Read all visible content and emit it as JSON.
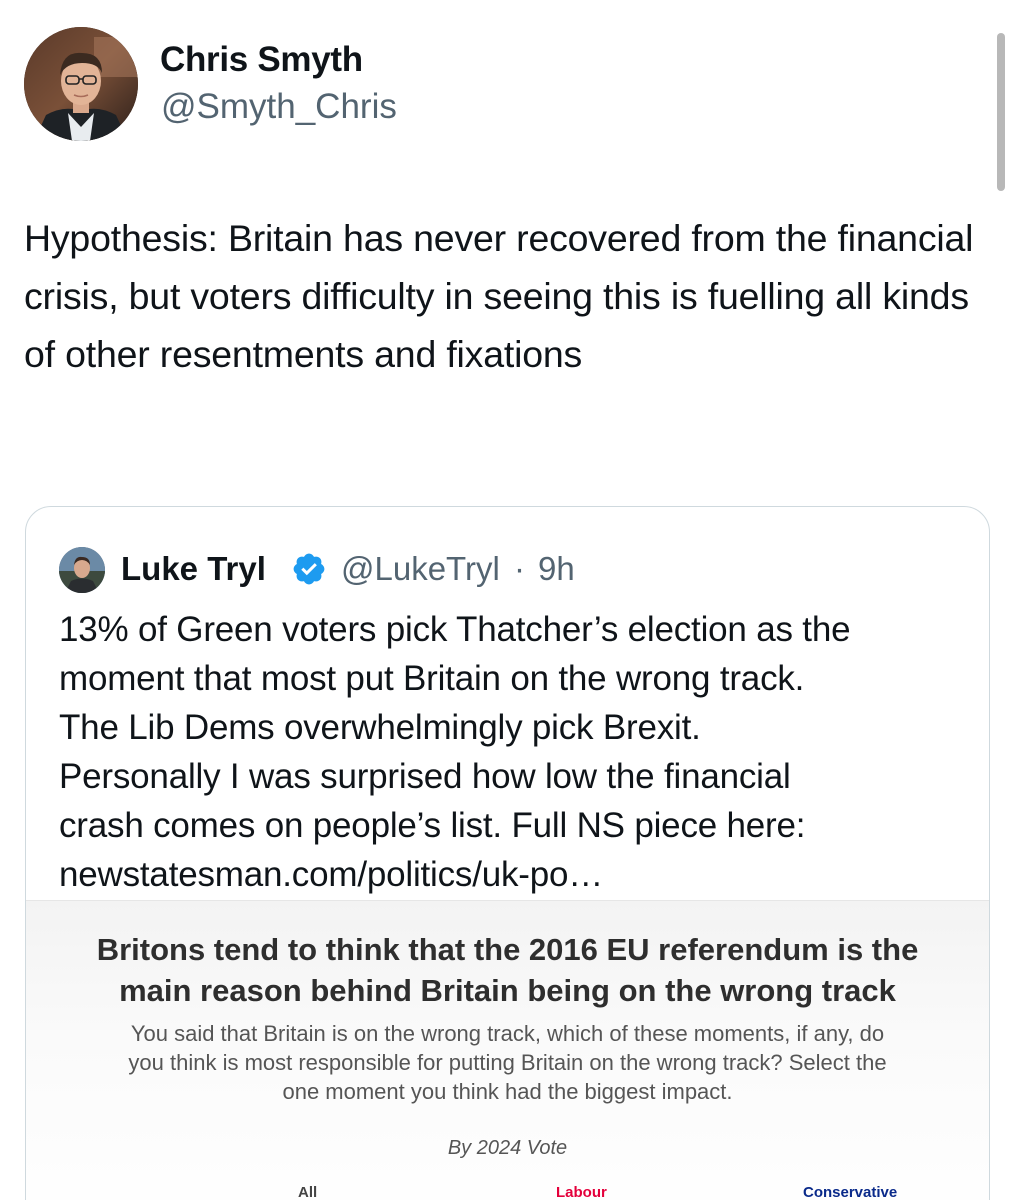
{
  "colors": {
    "handle_gray": "#536471",
    "text_dark": "#0f1419",
    "verified_blue": "#1d9bf0",
    "labour_red": "#e4003b",
    "conservative_blue": "#0a2a8a"
  },
  "author": {
    "name": "Chris Smyth",
    "handle": "@Smyth_Chris"
  },
  "tweet": {
    "text": "Hypothesis: Britain has never recovered from the financial crisis, but voters difficulty in seeing this is fuelling all kinds of other resentments and fixations"
  },
  "quoted": {
    "name": "Luke Tryl",
    "handle": "@LukeTryl",
    "separator": "·",
    "time": "9h",
    "verified_icon": "verified-badge-icon",
    "text_lines": [
      "13% of Green voters pick Thatcher’s  election as the",
      "moment that most put Britain on the wrong track.",
      "The Lib Dems overwhelmingly pick Brexit.",
      "Personally I was surprised how low the financial",
      "crash comes on people’s list. Full NS piece here:",
      "newstatesman.com/politics/uk-po…"
    ],
    "embed": {
      "title_lines": [
        "Britons tend to think that the 2016 EU referendum is the",
        "main reason behind Britain being on the wrong track"
      ],
      "subtitle_lines": [
        "You said that Britain is on the wrong track, which of these moments, if any, do",
        "you think is most responsible for putting Britain on the wrong track? Select the",
        "one moment you think had the biggest impact."
      ],
      "by_line": "By 2024 Vote",
      "columns": [
        "All",
        "Labour",
        "Conservative"
      ]
    }
  }
}
